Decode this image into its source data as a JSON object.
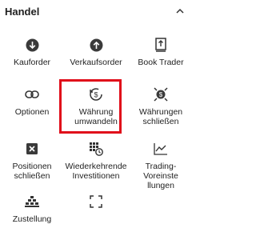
{
  "header": {
    "title": "Handel",
    "collapse_icon": "chevron-up-icon"
  },
  "tiles": [
    {
      "label": "Kauforder",
      "icon": "arrow-down-circle-icon"
    },
    {
      "label": "Verkaufsorder",
      "icon": "arrow-up-circle-icon"
    },
    {
      "label": "Book Trader",
      "icon": "book-trader-icon"
    },
    {
      "label": "Optionen",
      "icon": "link-icon"
    },
    {
      "label": "Währung\numwandeln",
      "icon": "currency-exchange-icon"
    },
    {
      "label": "Währungen\nschließen",
      "icon": "currency-close-icon"
    },
    {
      "label": "Positionen\nschließen",
      "icon": "close-box-icon"
    },
    {
      "label": "Wiederkehrende\nInvestitionen",
      "icon": "recurring-investment-icon"
    },
    {
      "label": "Trading-Voreinste\nllungen",
      "icon": "trend-line-icon"
    },
    {
      "label": "Zustellung",
      "icon": "delivery-icon"
    },
    {
      "label": "",
      "icon": "fullscreen-icon"
    }
  ],
  "highlight_color": "#e00d1a"
}
